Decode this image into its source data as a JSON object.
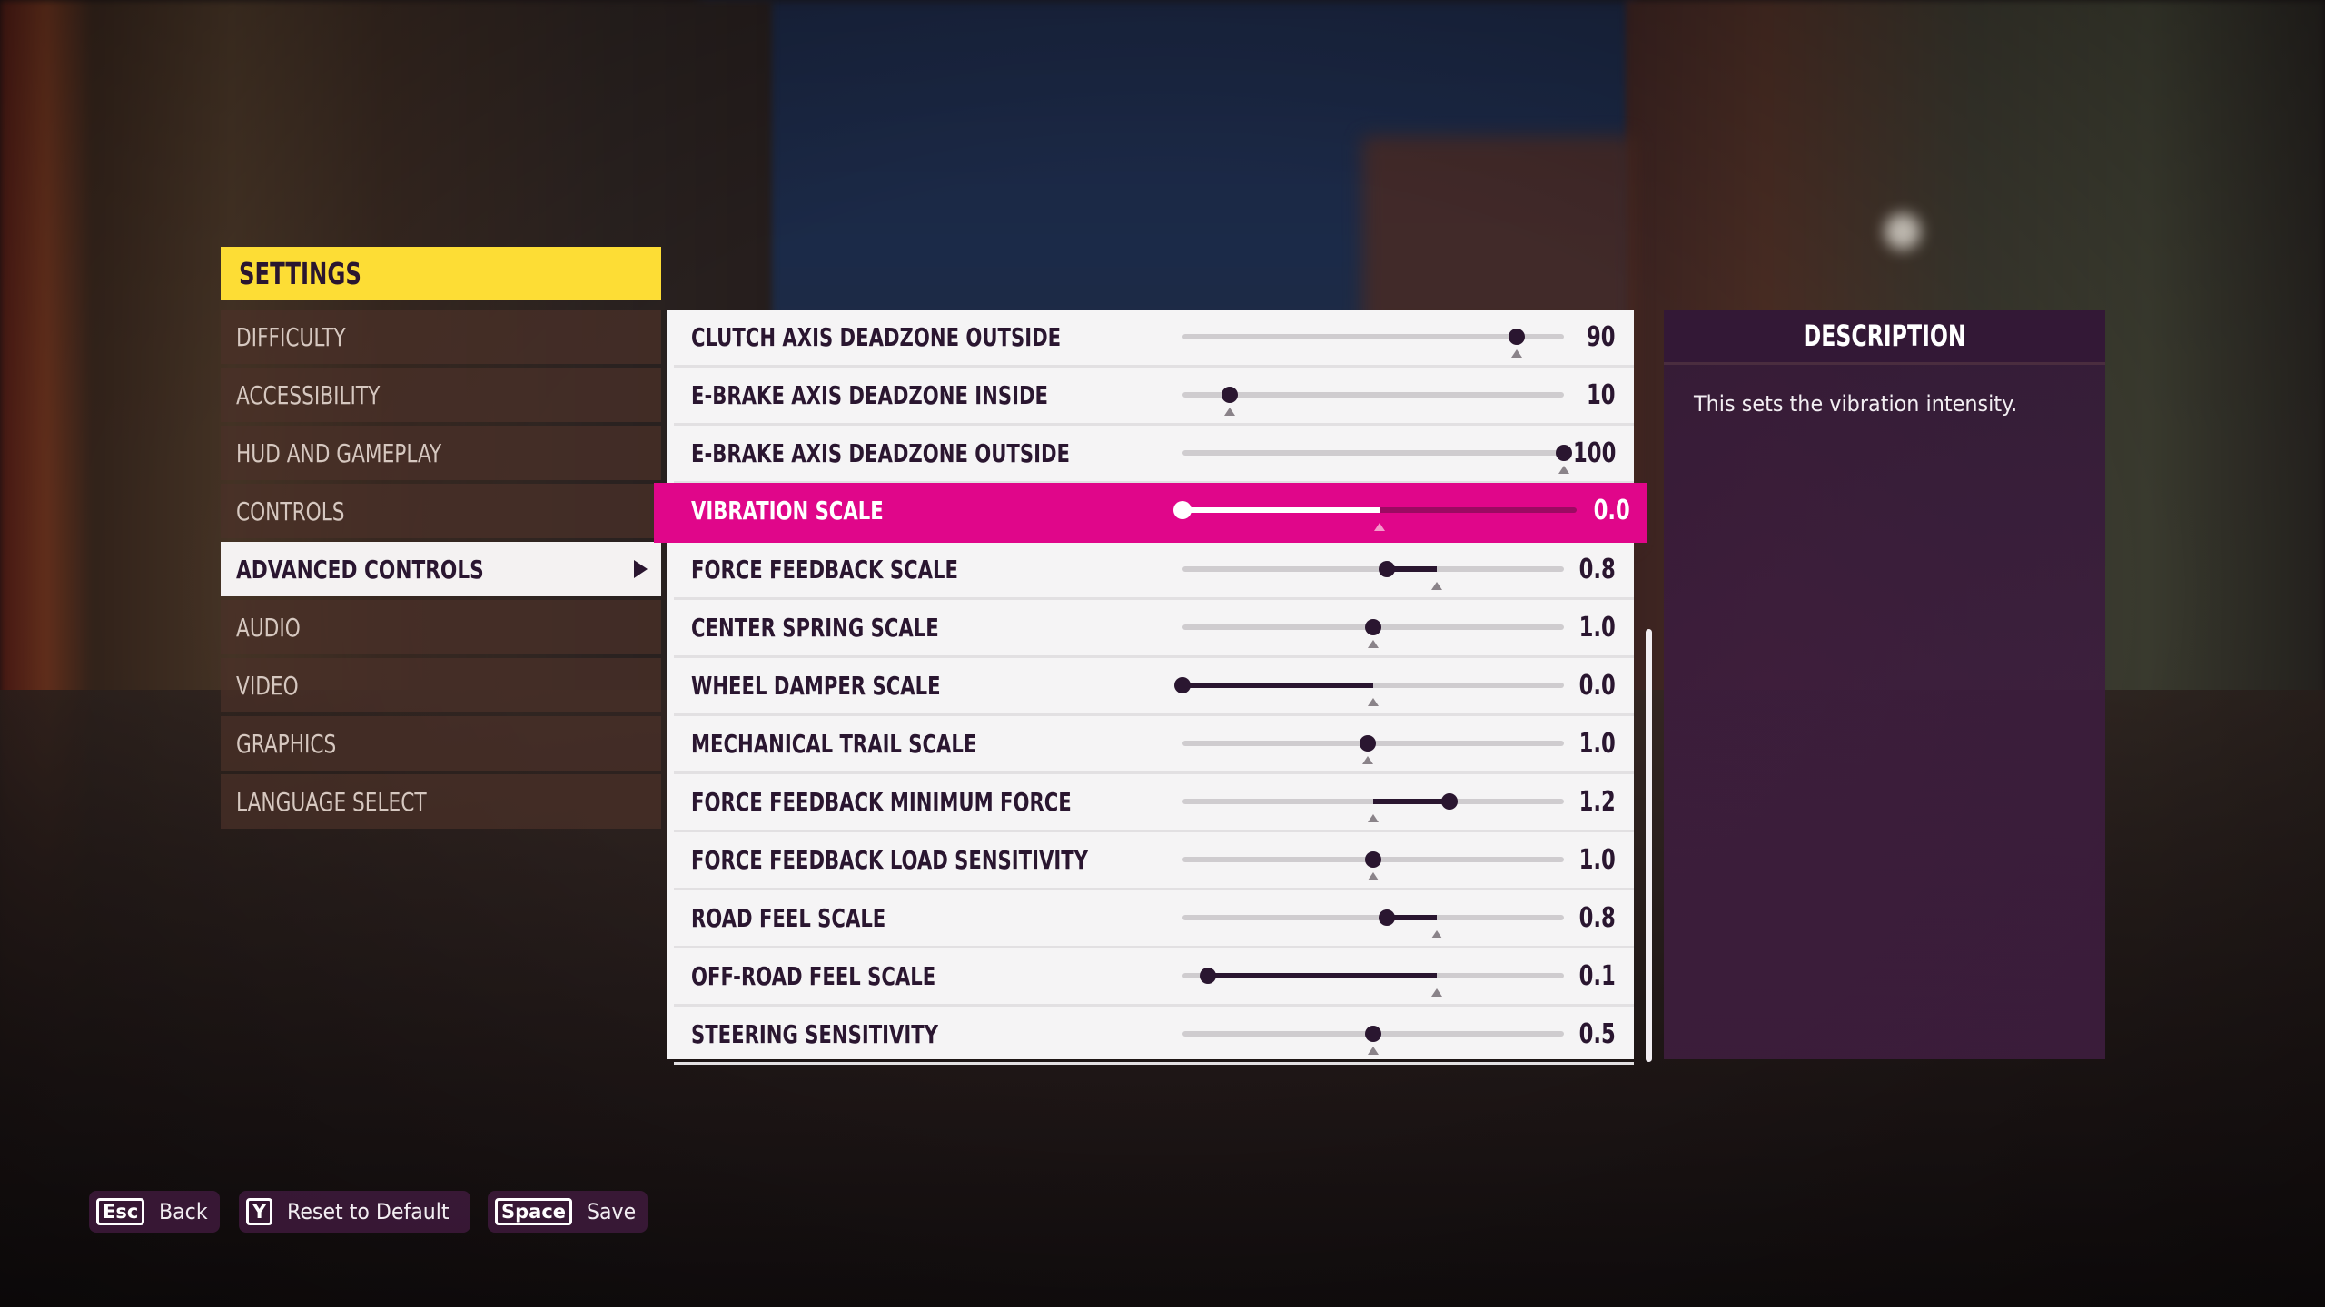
{
  "header": {
    "title": "SETTINGS"
  },
  "sidebar": {
    "items": [
      {
        "label": "DIFFICULTY",
        "active": false
      },
      {
        "label": "ACCESSIBILITY",
        "active": false
      },
      {
        "label": "HUD AND GAMEPLAY",
        "active": false
      },
      {
        "label": "CONTROLS",
        "active": false
      },
      {
        "label": "ADVANCED CONTROLS",
        "active": true
      },
      {
        "label": "AUDIO",
        "active": false
      },
      {
        "label": "VIDEO",
        "active": false
      },
      {
        "label": "GRAPHICS",
        "active": false
      },
      {
        "label": "LANGUAGE SELECT",
        "active": false
      }
    ]
  },
  "settings": {
    "rows": [
      {
        "label": "CLUTCH AXIS DEADZONE OUTSIDE",
        "value": "90",
        "position": 0.876,
        "default": 0.876,
        "highlighted": false
      },
      {
        "label": "E-BRAKE AXIS DEADZONE INSIDE",
        "value": "10",
        "position": 0.124,
        "default": 0.124,
        "highlighted": false
      },
      {
        "label": "E-BRAKE AXIS DEADZONE OUTSIDE",
        "value": "100",
        "position": 1.0,
        "default": 1.0,
        "highlighted": false
      },
      {
        "label": "VIBRATION SCALE",
        "value": "0.0",
        "position": 0.0,
        "default": 0.5,
        "highlighted": true
      },
      {
        "label": "FORCE FEEDBACK SCALE",
        "value": "0.8",
        "position": 0.536,
        "default": 0.667,
        "highlighted": false
      },
      {
        "label": "CENTER SPRING SCALE",
        "value": "1.0",
        "position": 0.5,
        "default": 0.5,
        "highlighted": false
      },
      {
        "label": "WHEEL DAMPER SCALE",
        "value": "0.0",
        "position": 0.0,
        "default": 0.5,
        "highlighted": false
      },
      {
        "label": "MECHANICAL TRAIL SCALE",
        "value": "1.0",
        "position": 0.486,
        "default": 0.486,
        "highlighted": false
      },
      {
        "label": "FORCE FEEDBACK MINIMUM FORCE",
        "value": "1.2",
        "position": 0.7,
        "default": 0.5,
        "highlighted": false
      },
      {
        "label": "FORCE FEEDBACK LOAD SENSITIVITY",
        "value": "1.0",
        "position": 0.5,
        "default": 0.5,
        "highlighted": false
      },
      {
        "label": "ROAD FEEL SCALE",
        "value": "0.8",
        "position": 0.536,
        "default": 0.667,
        "highlighted": false
      },
      {
        "label": "OFF-ROAD FEEL SCALE",
        "value": "0.1",
        "position": 0.067,
        "default": 0.667,
        "highlighted": false
      },
      {
        "label": "STEERING SENSITIVITY",
        "value": "0.5",
        "position": 0.5,
        "default": 0.5,
        "highlighted": false
      }
    ]
  },
  "description": {
    "title": "DESCRIPTION",
    "text": "This sets the vibration intensity."
  },
  "footer": {
    "buttons": [
      {
        "key": "Esc",
        "label": "Back",
        "icon": "esc-key-icon"
      },
      {
        "key": "Y",
        "label": "Reset to Default",
        "icon": "y-key-icon"
      },
      {
        "key": "Space",
        "label": "Save",
        "icon": "space-key-icon"
      }
    ]
  },
  "colors": {
    "header_accent": "#FDDD35",
    "highlight": "#E0068A",
    "text_dark": "#2a1630",
    "panel_purple": "#331836"
  }
}
